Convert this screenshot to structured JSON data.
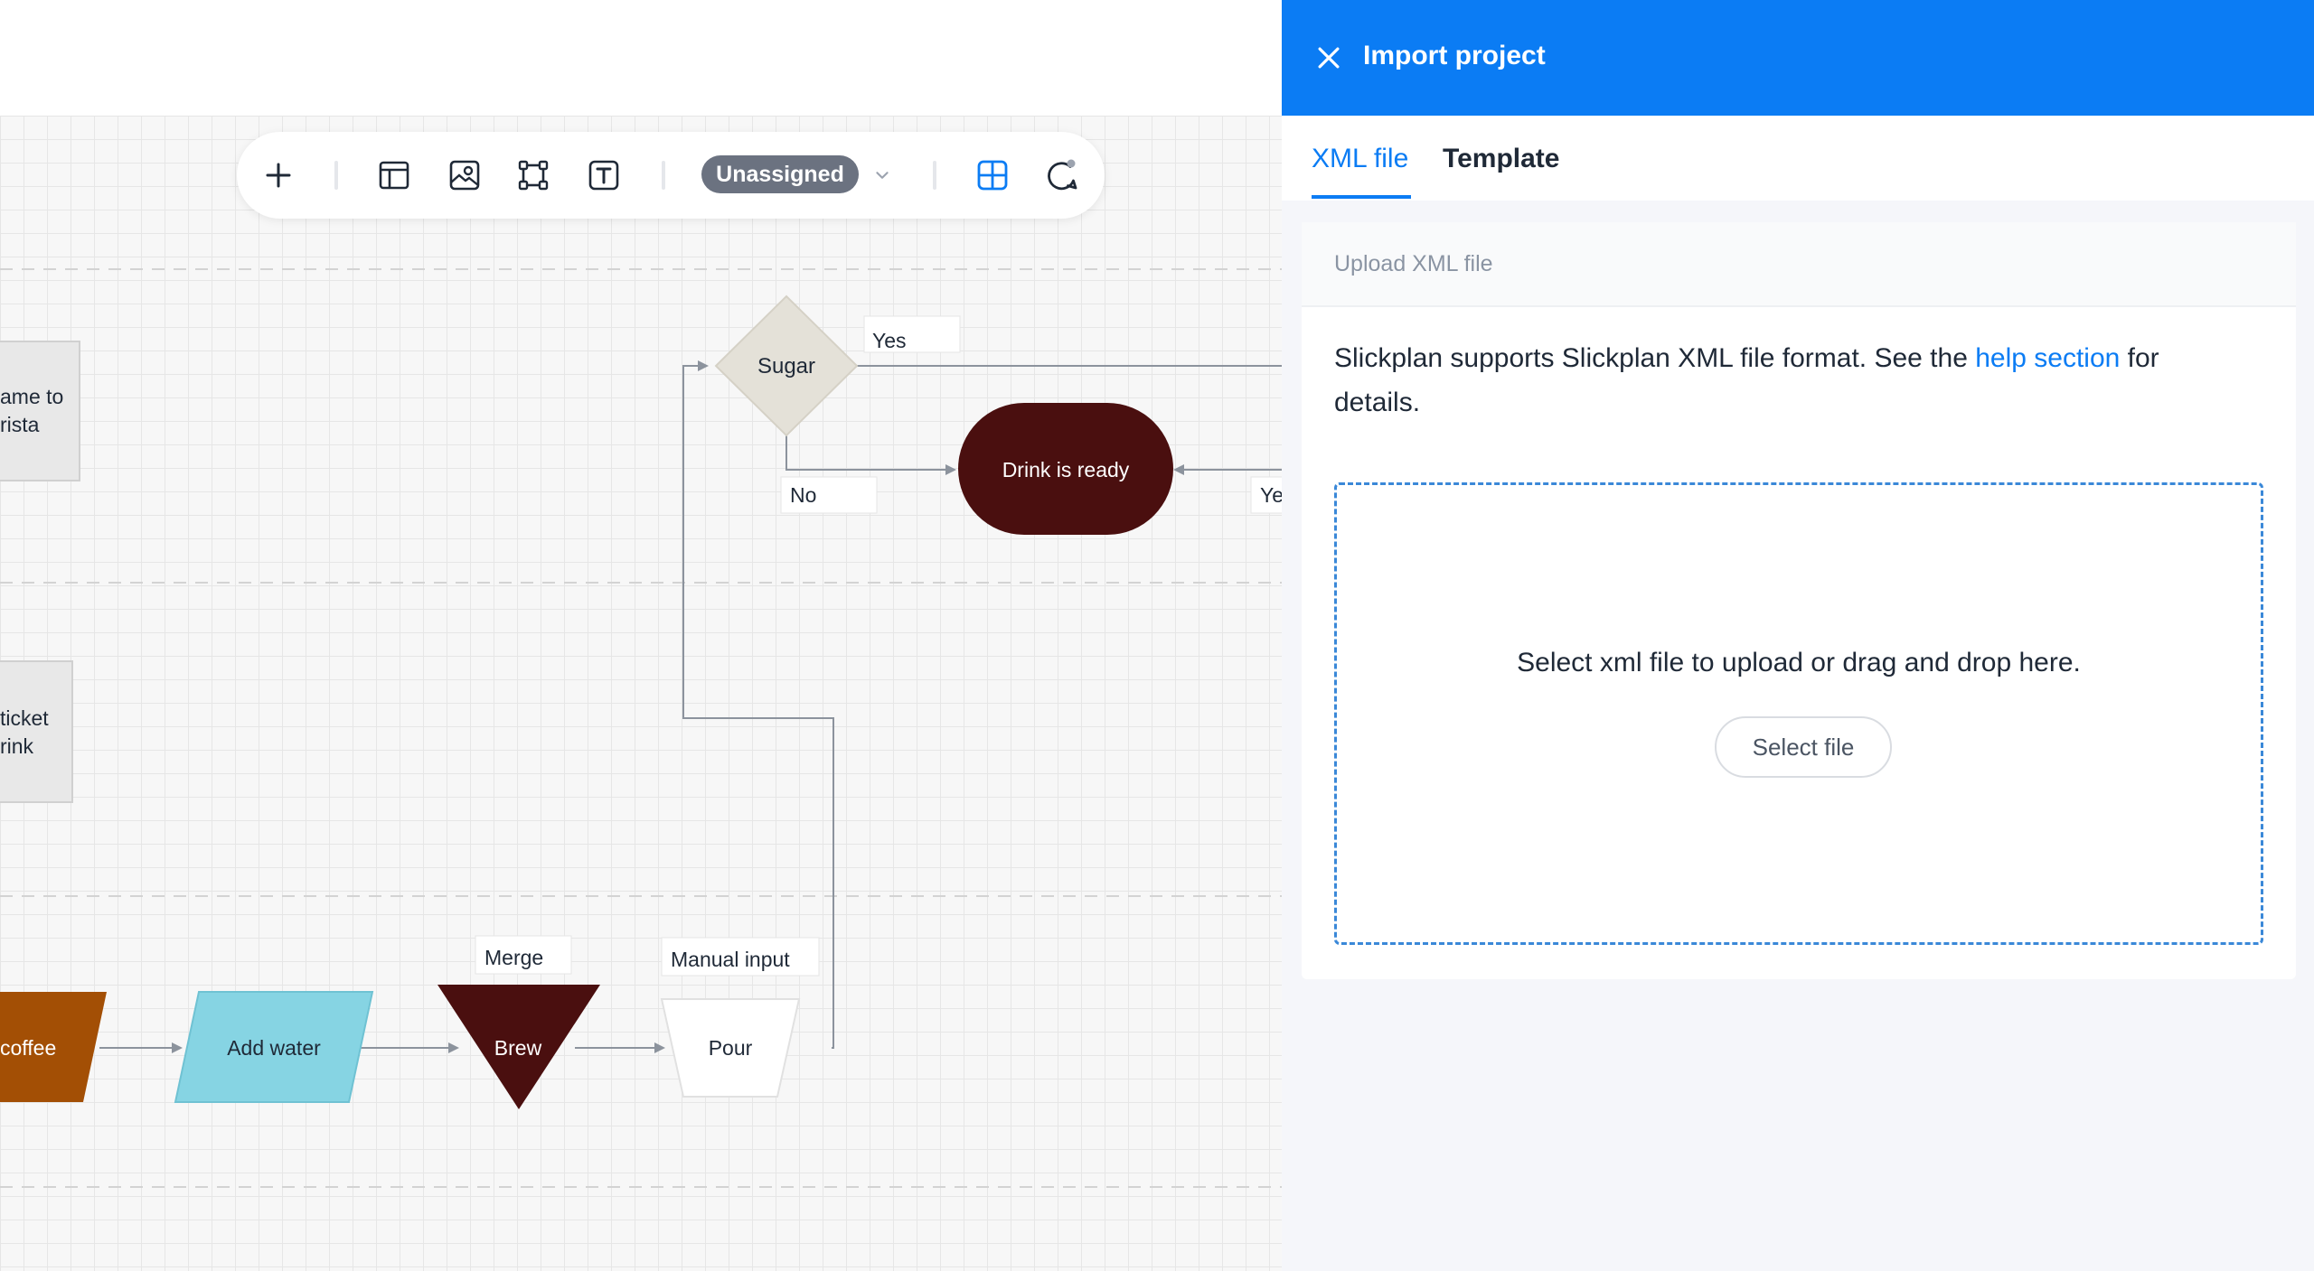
{
  "panel": {
    "title": "Import project",
    "tabs": [
      {
        "label": "XML file",
        "active": true
      },
      {
        "label": "Template",
        "active": false
      }
    ],
    "section_label": "Upload XML file",
    "description_pre": "Slickplan supports Slickplan XML file format. See the ",
    "description_link": "help section",
    "description_post": " for details.",
    "dropzone_text": "Select xml file to upload or drag and drop here.",
    "select_button": "Select file"
  },
  "toolbar": {
    "assignee_label": "Unassigned",
    "icons": [
      "plus-icon",
      "layout-icon",
      "image-icon",
      "frame-icon",
      "text-icon",
      "chevron-down-icon",
      "grid-icon",
      "comment-icon"
    ]
  },
  "diagram": {
    "nodes": {
      "barista_partial": [
        "ame to",
        "rista"
      ],
      "ticket_partial": [
        "ticket",
        "rink"
      ],
      "sugar": "Sugar",
      "drink_ready": "Drink is ready",
      "coffee_partial": "coffee",
      "add_water": "Add water",
      "brew": "Brew",
      "pour": "Pour"
    },
    "labels": {
      "yes": "Yes",
      "no": "No",
      "yes_partial": "Ye",
      "merge": "Merge",
      "manual_input": "Manual input"
    }
  },
  "colors": {
    "accent": "#0b7cf4",
    "drink_ready": "#4a0f0f",
    "brew": "#4a0f0f",
    "coffee": "#a34f05",
    "add_water": "#86d4e3",
    "sugar": "#e4e1d8"
  }
}
